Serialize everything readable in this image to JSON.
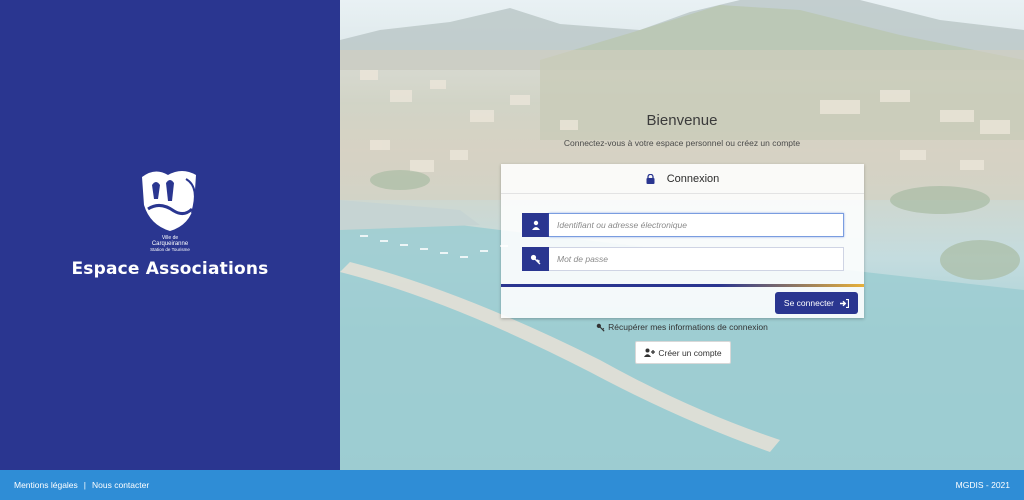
{
  "brand": {
    "logo_text_line1": "Ville de",
    "logo_text_line2": "Carqueiranne",
    "logo_text_line3": "Station de Tourisme",
    "title": "Espace Associations"
  },
  "welcome": {
    "title": "Bienvenue",
    "subtitle": "Connectez-vous à votre espace personnel ou créez un compte"
  },
  "login": {
    "heading": "Connexion",
    "username_placeholder": "Identifiant ou adresse électronique",
    "password_placeholder": "Mot de passe",
    "submit_label": "Se connecter"
  },
  "links": {
    "recover": "Récupérer mes informations de connexion",
    "create_account": "Créer un compte"
  },
  "footer": {
    "legal": "Mentions légales",
    "separator": "|",
    "contact": "Nous contacter",
    "copyright": "MGDIS - 2021"
  },
  "colors": {
    "primary": "#2a3690",
    "footer": "#2f8dd6",
    "accent": "#e7b03a"
  }
}
